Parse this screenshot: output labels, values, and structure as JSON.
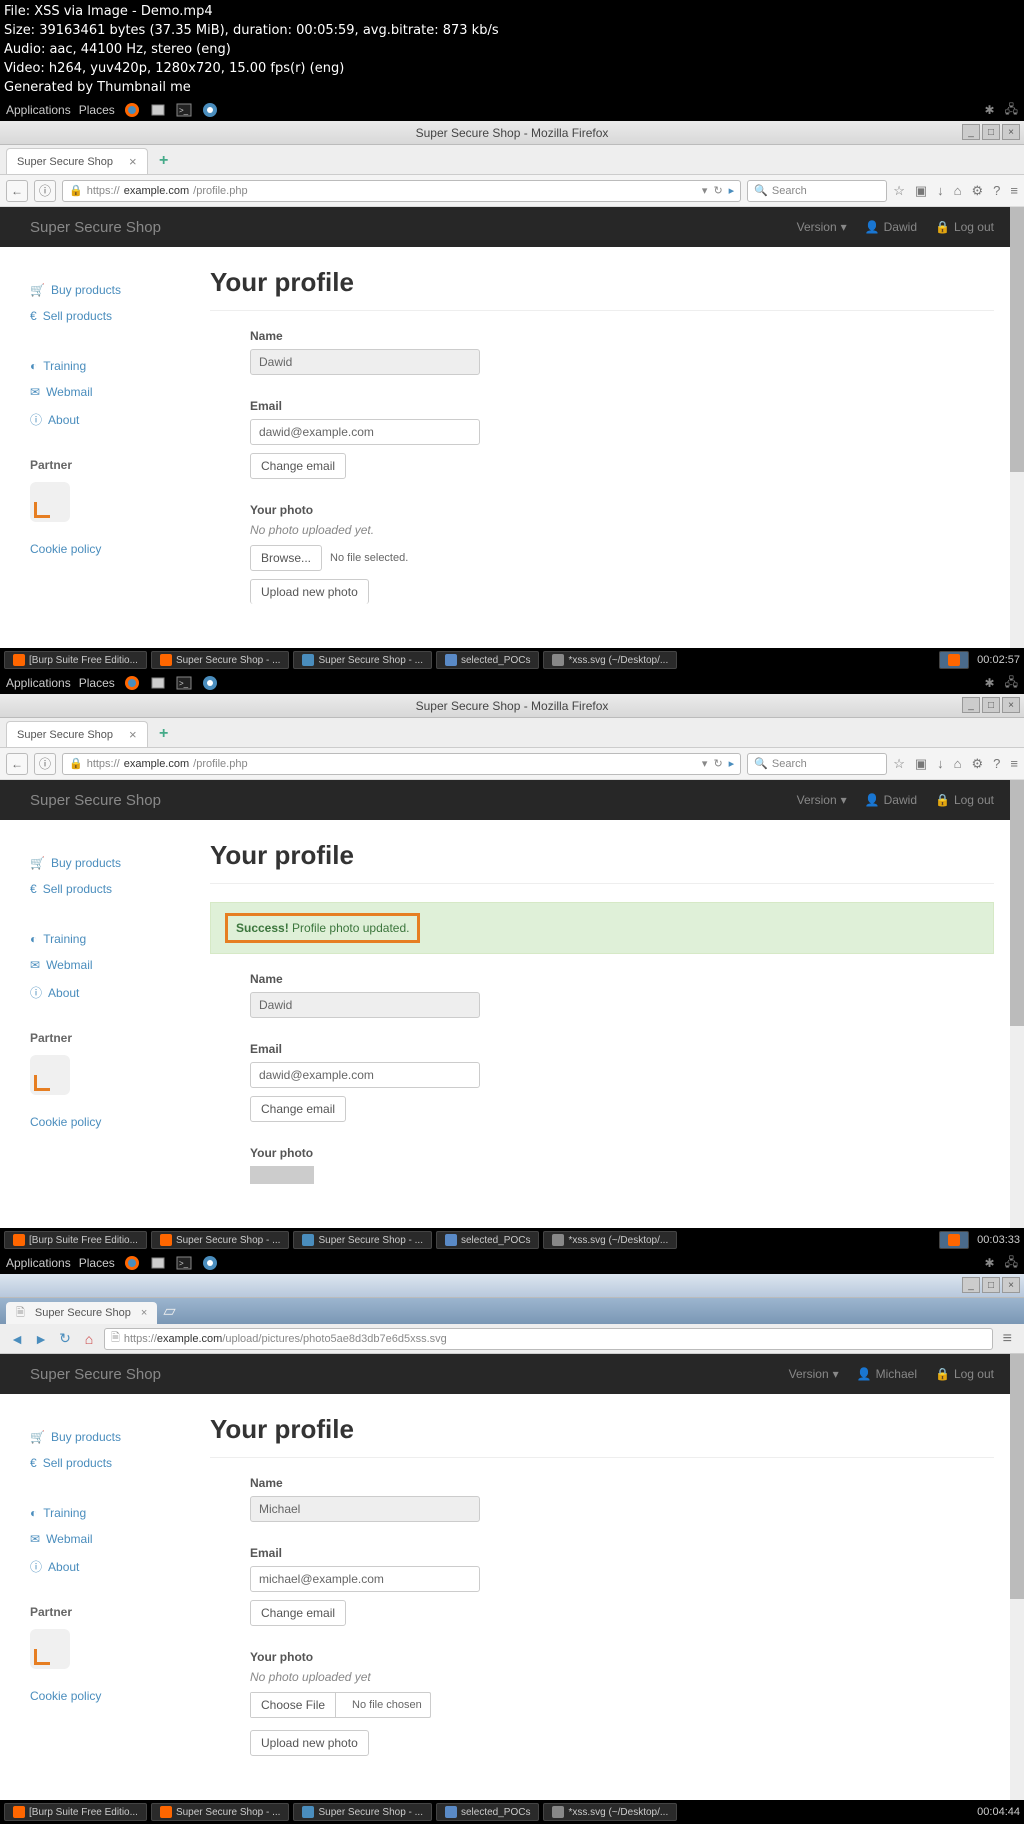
{
  "video_info": {
    "file": "File: XSS via Image - Demo.mp4",
    "size": "Size: 39163461 bytes (37.35 MiB), duration: 00:05:59, avg.bitrate: 873 kb/s",
    "audio": "Audio: aac, 44100 Hz, stereo (eng)",
    "video": "Video: h264, yuv420p, 1280x720, 15.00 fps(r) (eng)",
    "gen": "Generated by Thumbnail me"
  },
  "frames": [
    {
      "topbar": {
        "apps": "Applications",
        "places": "Places"
      },
      "window_title": "Super Secure Shop - Mozilla Firefox",
      "tab": "Super Secure Shop",
      "url_prefix": "https://",
      "url_host": "example.com",
      "url_path": "/profile.php",
      "search_ph": "Search",
      "navbar": {
        "brand": "Super Secure Shop",
        "version": "Version",
        "user": "Dawid",
        "logout": "Log out"
      },
      "sidebar": {
        "buy": "Buy products",
        "sell": "Sell products",
        "training": "Training",
        "webmail": "Webmail",
        "about": "About",
        "partner": "Partner",
        "cookie": "Cookie policy"
      },
      "page": {
        "title": "Your profile",
        "name_label": "Name",
        "name_value": "Dawid",
        "email_label": "Email",
        "email_value": "dawid@example.com",
        "change_email": "Change email",
        "photo_label": "Your photo",
        "photo_note": "No photo uploaded yet.",
        "browse": "Browse...",
        "no_file": "No file selected.",
        "upload": "Upload new photo"
      },
      "taskbar": {
        "items": [
          "[Burp Suite Free Editio...",
          "Super Secure Shop - ...",
          "Super Secure Shop - ...",
          "selected_POCs",
          "*xss.svg (~/Desktop/..."
        ],
        "time": "00:02:57"
      }
    },
    {
      "topbar": {
        "apps": "Applications",
        "places": "Places"
      },
      "window_title": "Super Secure Shop - Mozilla Firefox",
      "tab": "Super Secure Shop",
      "url_prefix": "https://",
      "url_host": "example.com",
      "url_path": "/profile.php",
      "search_ph": "Search",
      "navbar": {
        "brand": "Super Secure Shop",
        "version": "Version",
        "user": "Dawid",
        "logout": "Log out"
      },
      "sidebar": {
        "buy": "Buy products",
        "sell": "Sell products",
        "training": "Training",
        "webmail": "Webmail",
        "about": "About",
        "partner": "Partner",
        "cookie": "Cookie policy"
      },
      "page": {
        "title": "Your profile",
        "alert_strong": "Success!",
        "alert_msg": "Profile photo updated.",
        "name_label": "Name",
        "name_value": "Dawid",
        "email_label": "Email",
        "email_value": "dawid@example.com",
        "change_email": "Change email",
        "photo_label": "Your photo"
      },
      "taskbar": {
        "items": [
          "[Burp Suite Free Editio...",
          "Super Secure Shop - ...",
          "Super Secure Shop - ...",
          "selected_POCs",
          "*xss.svg (~/Desktop/..."
        ],
        "time": "00:03:33"
      }
    },
    {
      "topbar": {
        "apps": "Applications",
        "places": "Places"
      },
      "tab": "Super Secure Shop",
      "url": "https://example.com/upload/pictures/photo5ae8d3db7e6d5xss.svg",
      "navbar": {
        "brand": "Super Secure Shop",
        "version": "Version",
        "user": "Michael",
        "logout": "Log out"
      },
      "sidebar": {
        "buy": "Buy products",
        "sell": "Sell products",
        "training": "Training",
        "webmail": "Webmail",
        "about": "About",
        "partner": "Partner",
        "cookie": "Cookie policy"
      },
      "page": {
        "title": "Your profile",
        "name_label": "Name",
        "name_value": "Michael",
        "email_label": "Email",
        "email_value": "michael@example.com",
        "change_email": "Change email",
        "photo_label": "Your photo",
        "photo_note": "No photo uploaded yet",
        "choose": "Choose File",
        "no_file": "No file chosen",
        "upload": "Upload new photo"
      },
      "taskbar": {
        "items": [
          "[Burp Suite Free Editio...",
          "Super Secure Shop - ...",
          "Super Secure Shop - ...",
          "selected_POCs",
          "*xss.svg (~/Desktop/..."
        ],
        "time": "00:04:44"
      }
    }
  ]
}
